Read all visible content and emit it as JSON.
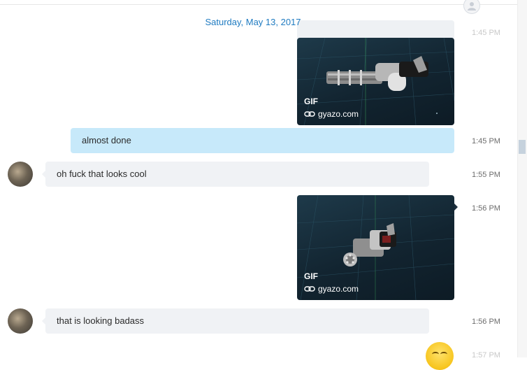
{
  "chat": {
    "date_header": "Saturday, May 13, 2017",
    "messages": [
      {
        "type": "gif",
        "direction": "out",
        "label": "GIF",
        "source": "gyazo.com",
        "time": "1:45 PM",
        "icon": "minigun"
      },
      {
        "type": "text",
        "direction": "out",
        "text": "almost done",
        "time": "1:45 PM"
      },
      {
        "type": "text",
        "direction": "in",
        "text": "oh fuck that looks cool",
        "time": "1:55 PM"
      },
      {
        "type": "gif",
        "direction": "out",
        "label": "GIF",
        "source": "gyazo.com",
        "time": "1:56 PM",
        "icon": "minigun"
      },
      {
        "type": "text",
        "direction": "in",
        "text": "that is looking badass",
        "time": "1:56 PM"
      },
      {
        "type": "emoji",
        "direction": "out",
        "icon": "smile-emoji",
        "time": "1:57 PM"
      }
    ]
  },
  "colors": {
    "outgoing_bubble": "#c7e9fa",
    "incoming_bubble": "#f0f2f5",
    "date_text": "#1f7bc1",
    "gif_background": "#122430"
  }
}
